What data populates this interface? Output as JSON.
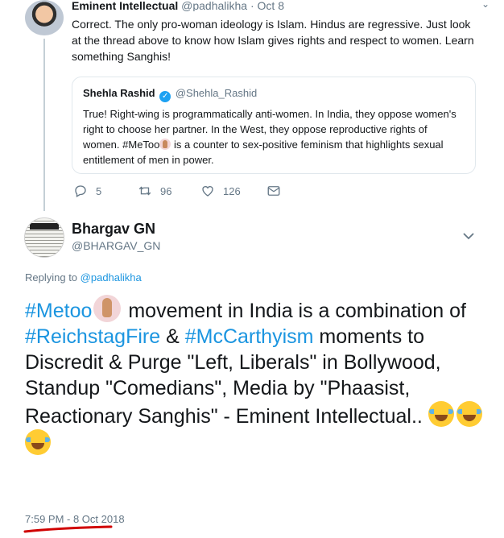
{
  "colors": {
    "link": "#1b95e0",
    "secondary": "#657786",
    "text": "#14171a",
    "verified": "#1da1f2",
    "annotation": "#d00000"
  },
  "top_tweet": {
    "name": "Eminent Intellectual",
    "handle": "@padhalikha",
    "separator": "·",
    "date": "Oct 8",
    "text": "Correct. The only pro-woman ideology is Islam. Hindus are regressive. Just look at the thread above to know how Islam gives rights and respect to women. Learn something Sanghis!",
    "quoted": {
      "name": "Shehla Rashid",
      "handle": "@Shehla_Rashid",
      "text_before": "True! Right-wing is programmatically anti-women. In India, they oppose women's right to choose her partner. In the West, they oppose reproductive rights of women. #MeToo",
      "text_after": " is a counter to sex-positive feminism that highlights sexual entitlement of men in power."
    },
    "actions": {
      "replies": "5",
      "retweets": "96",
      "likes": "126"
    }
  },
  "main_tweet": {
    "name": "Bhargav GN",
    "handle": "@BHARGAV_GN",
    "replying_prefix": "Replying to",
    "replying_handle": "@padhalikha",
    "body": {
      "tag1": "#Metoo",
      "part1": " movement in India is a combination of ",
      "tag2": "#ReichstagFire",
      "part2": " & ",
      "tag3": "#McCarthyism",
      "part3": " moments to Discredit & Purge \"Left, Liberals\" in Bollywood, Standup \"Comedians\", Media by \"Phaasist, Reactionary Sanghis\" - Eminent Intellectual.. "
    },
    "timestamp": "7:59 PM - 8 Oct 2018"
  },
  "icons": [
    "reply-icon",
    "retweet-icon",
    "like-icon",
    "direct-message-icon",
    "verified-badge-icon",
    "chevron-down-icon",
    "raised-hand-emoji",
    "tears-of-joy-emoji"
  ]
}
